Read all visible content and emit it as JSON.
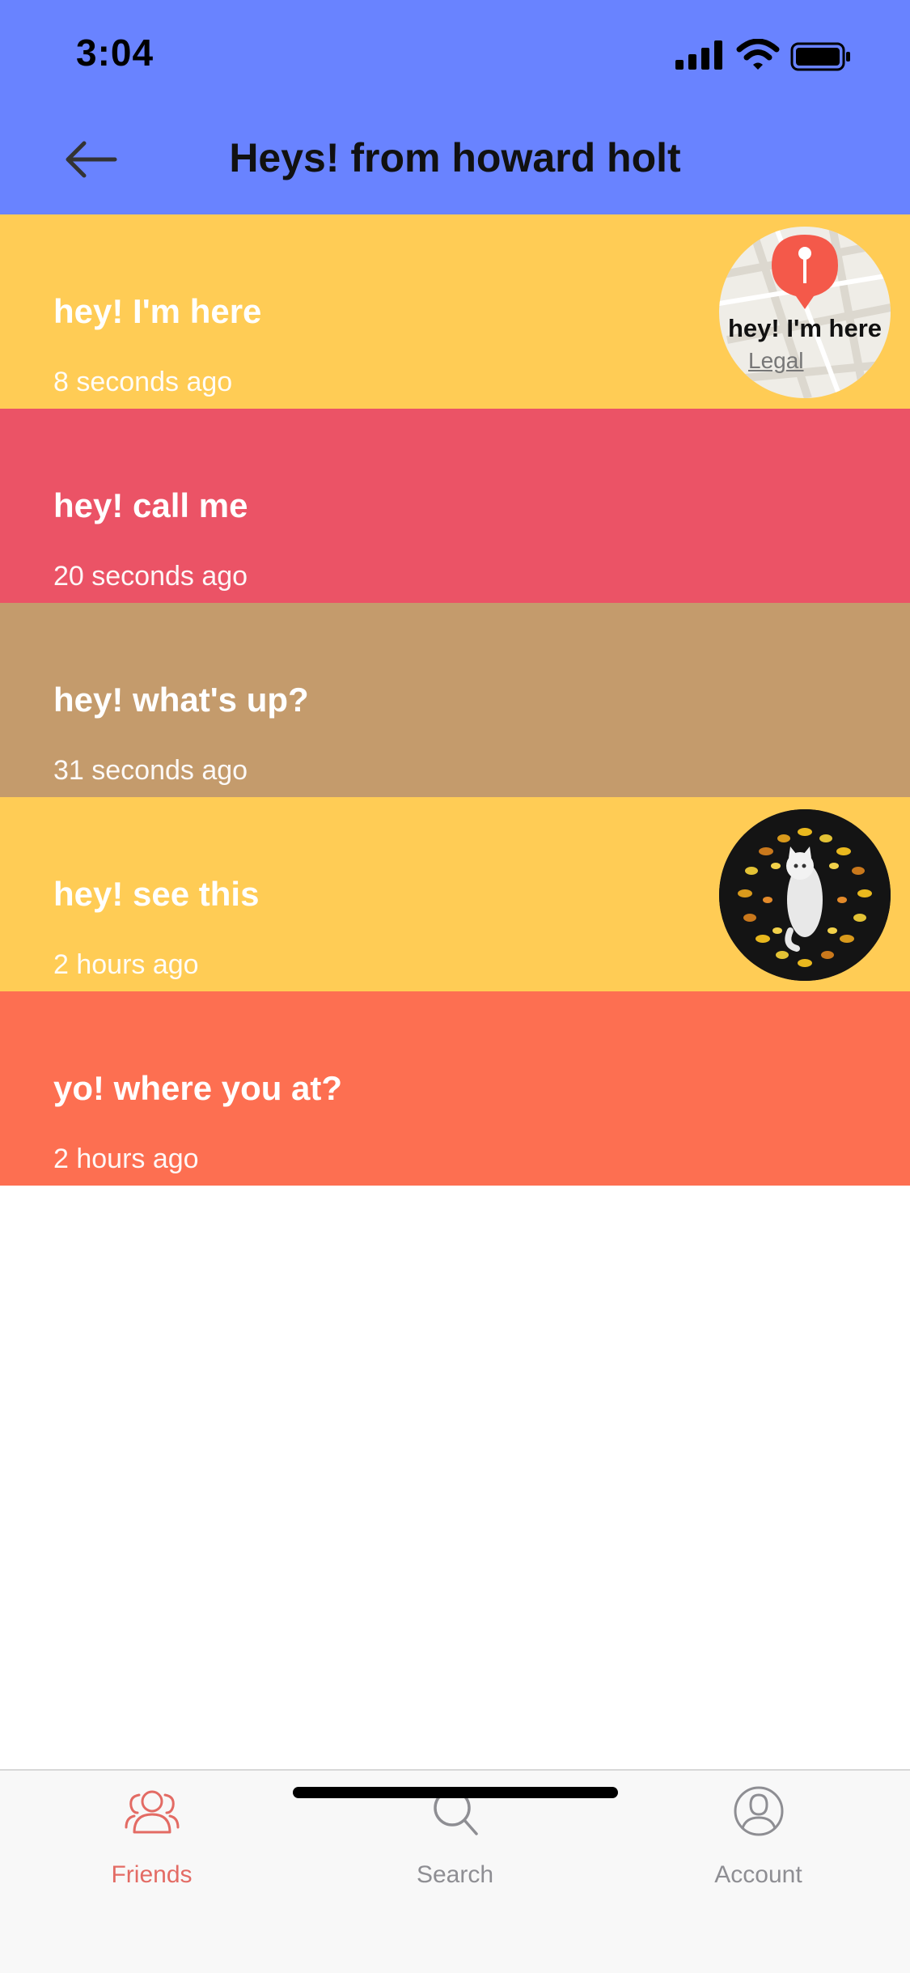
{
  "status_bar": {
    "time": "3:04"
  },
  "header": {
    "title": "Heys! from howard holt"
  },
  "messages": [
    {
      "text": "hey! I'm here",
      "time": "8 seconds ago",
      "color": "#FFCC55"
    },
    {
      "text": "hey! call me",
      "time": "20 seconds ago",
      "color": "#EB5366"
    },
    {
      "text": "hey! what's up?",
      "time": "31 seconds ago",
      "color": "#C49B6C"
    },
    {
      "text": "hey! see this",
      "time": "2 hours ago",
      "color": "#FFCC55"
    },
    {
      "text": "yo! where you at?",
      "time": "2 hours ago",
      "color": "#FD6F51"
    }
  ],
  "map_thumbnail": {
    "label": "hey! I'm here",
    "legal": "Legal",
    "pin_color": "#F4594A"
  },
  "tabbar": {
    "tabs": [
      {
        "label": "Friends",
        "icon": "friends-icon",
        "active": true
      },
      {
        "label": "Search",
        "icon": "search-icon",
        "active": false
      },
      {
        "label": "Account",
        "icon": "account-icon",
        "active": false
      }
    ]
  },
  "colors": {
    "header": "#6983FF",
    "active_tab": "#E36B64",
    "inactive_tab": "#8E8E93"
  }
}
